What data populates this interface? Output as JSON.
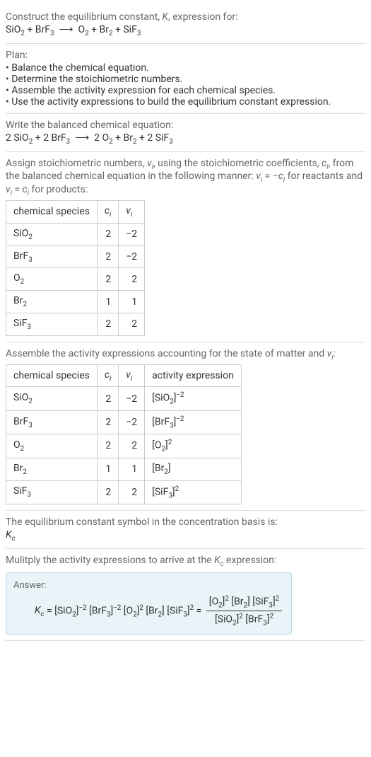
{
  "sections": {
    "construct": {
      "heading": "Construct the equilibrium constant, K, expression for:",
      "equation": "SiO₂ + BrF₃ ⟶ O₂ + Br₂ + SiF₃"
    },
    "plan": {
      "heading": "Plan:",
      "items": [
        "• Balance the chemical equation.",
        "• Determine the stoichiometric numbers.",
        "• Assemble the activity expression for each chemical species.",
        "• Use the activity expressions to build the equilibrium constant expression."
      ]
    },
    "balanced": {
      "heading": "Write the balanced chemical equation:",
      "equation": "2 SiO₂ + 2 BrF₃ ⟶ 2 O₂ + Br₂ + 2 SiF₃"
    },
    "assign": {
      "heading": "Assign stoichiometric numbers, νᵢ, using the stoichiometric coefficients, cᵢ, from the balanced chemical equation in the following manner: νᵢ = −cᵢ for reactants and νᵢ = cᵢ for products:",
      "table": {
        "headers": [
          "chemical species",
          "cᵢ",
          "νᵢ"
        ],
        "rows": [
          {
            "species": "SiO₂",
            "ci": "2",
            "vi": "−2"
          },
          {
            "species": "BrF₃",
            "ci": "2",
            "vi": "−2"
          },
          {
            "species": "O₂",
            "ci": "2",
            "vi": "2"
          },
          {
            "species": "Br₂",
            "ci": "1",
            "vi": "1"
          },
          {
            "species": "SiF₃",
            "ci": "2",
            "vi": "2"
          }
        ]
      }
    },
    "assemble": {
      "heading": "Assemble the activity expressions accounting for the state of matter and νᵢ:",
      "table": {
        "headers": [
          "chemical species",
          "cᵢ",
          "νᵢ",
          "activity expression"
        ],
        "rows": [
          {
            "species": "SiO₂",
            "ci": "2",
            "vi": "−2",
            "activity": "[SiO₂]⁻²"
          },
          {
            "species": "BrF₃",
            "ci": "2",
            "vi": "−2",
            "activity": "[BrF₃]⁻²"
          },
          {
            "species": "O₂",
            "ci": "2",
            "vi": "2",
            "activity": "[O₂]²"
          },
          {
            "species": "Br₂",
            "ci": "1",
            "vi": "1",
            "activity": "[Br₂]"
          },
          {
            "species": "SiF₃",
            "ci": "2",
            "vi": "2",
            "activity": "[SiF₃]²"
          }
        ]
      }
    },
    "symbol": {
      "heading": "The equilibrium constant symbol in the concentration basis is:",
      "content": "K_c"
    },
    "multiply": {
      "heading": "Mulitply the activity expressions to arrive at the K_c expression:",
      "answer_label": "Answer:",
      "answer_left": "K_c = [SiO₂]⁻² [BrF₃]⁻² [O₂]² [Br₂] [SiF₃]² = ",
      "answer_num": "[O₂]² [Br₂] [SiF₃]²",
      "answer_den": "[SiO₂]² [BrF₃]²"
    }
  }
}
